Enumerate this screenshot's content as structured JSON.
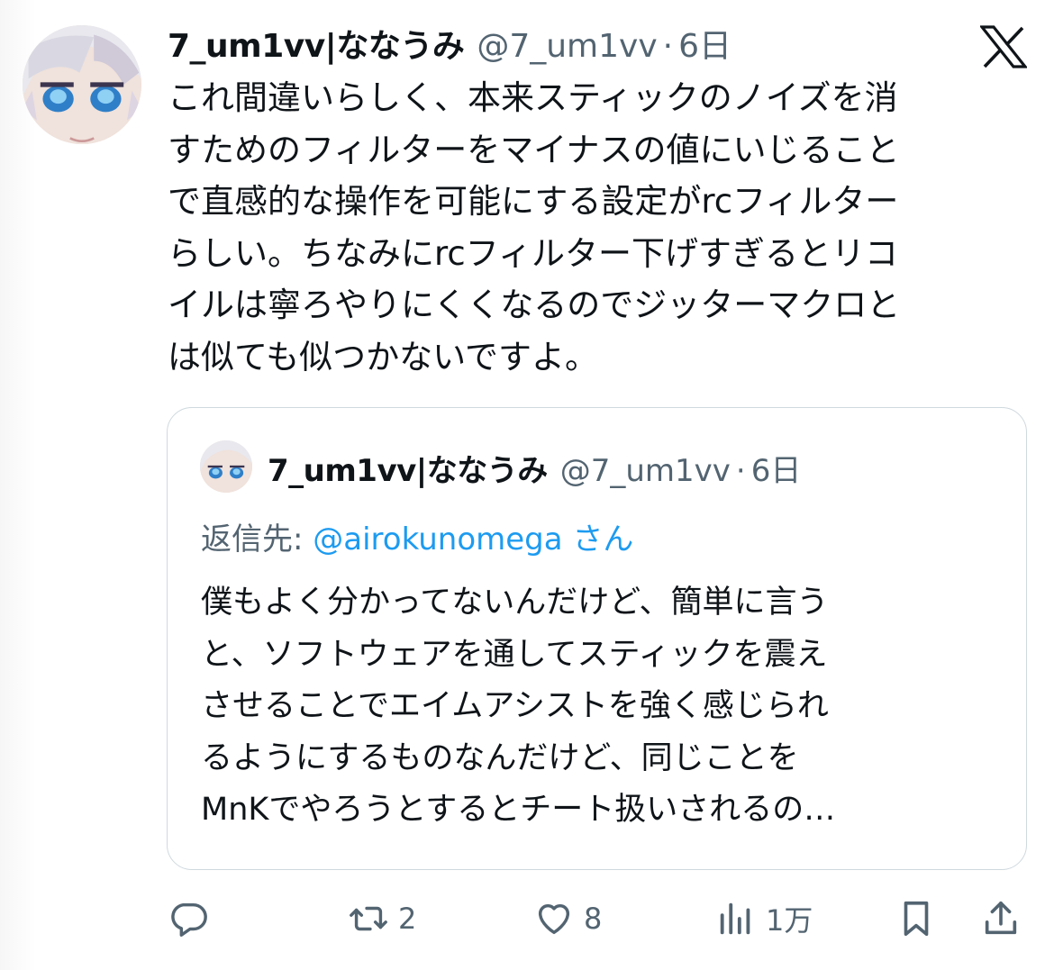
{
  "tweet": {
    "display_name": "7_um1vv|ななうみ",
    "handle": "@7_um1vv",
    "separator": "·",
    "time": "6日",
    "logo_icon": "x-logo-icon",
    "body_lines": [
      "これ間違いらしく、本来スティックのノイズを消",
      "すためのフィルターをマイナスの値にいじること",
      "で直感的な操作を可能にする設定がrcフィルター",
      "らしい。ちなみにrcフィルター下げすぎるとリコ",
      "イルは寧ろやりにくくなるのでジッターマクロと",
      "は似ても似つかないですよ。"
    ]
  },
  "quote": {
    "display_name": "7_um1vv|ななうみ",
    "handle": "@7_um1vv",
    "separator": "·",
    "time": "6日",
    "reply_prefix": "返信先: ",
    "reply_mention": "@airokunomega",
    "reply_suffix": " さん",
    "body_lines": [
      "僕もよく分かってないんだけど、簡単に言う",
      "と、ソフトウェアを通してスティックを震え",
      "させることでエイムアシストを強く感じられ",
      "るようにするものなんだけど、同じことを",
      "MnKでやろうとするとチート扱いされるの…"
    ]
  },
  "actions": {
    "reply": {
      "icon": "reply-icon",
      "count": ""
    },
    "retweet": {
      "icon": "retweet-icon",
      "count": "2"
    },
    "like": {
      "icon": "heart-icon",
      "count": "8"
    },
    "views": {
      "icon": "views-icon",
      "count": "1万"
    },
    "bookmark": {
      "icon": "bookmark-icon"
    },
    "share": {
      "icon": "share-icon"
    }
  },
  "colors": {
    "text": "#0f1419",
    "secondary": "#536471",
    "link": "#1d9bf0",
    "border": "#cfd9de"
  }
}
